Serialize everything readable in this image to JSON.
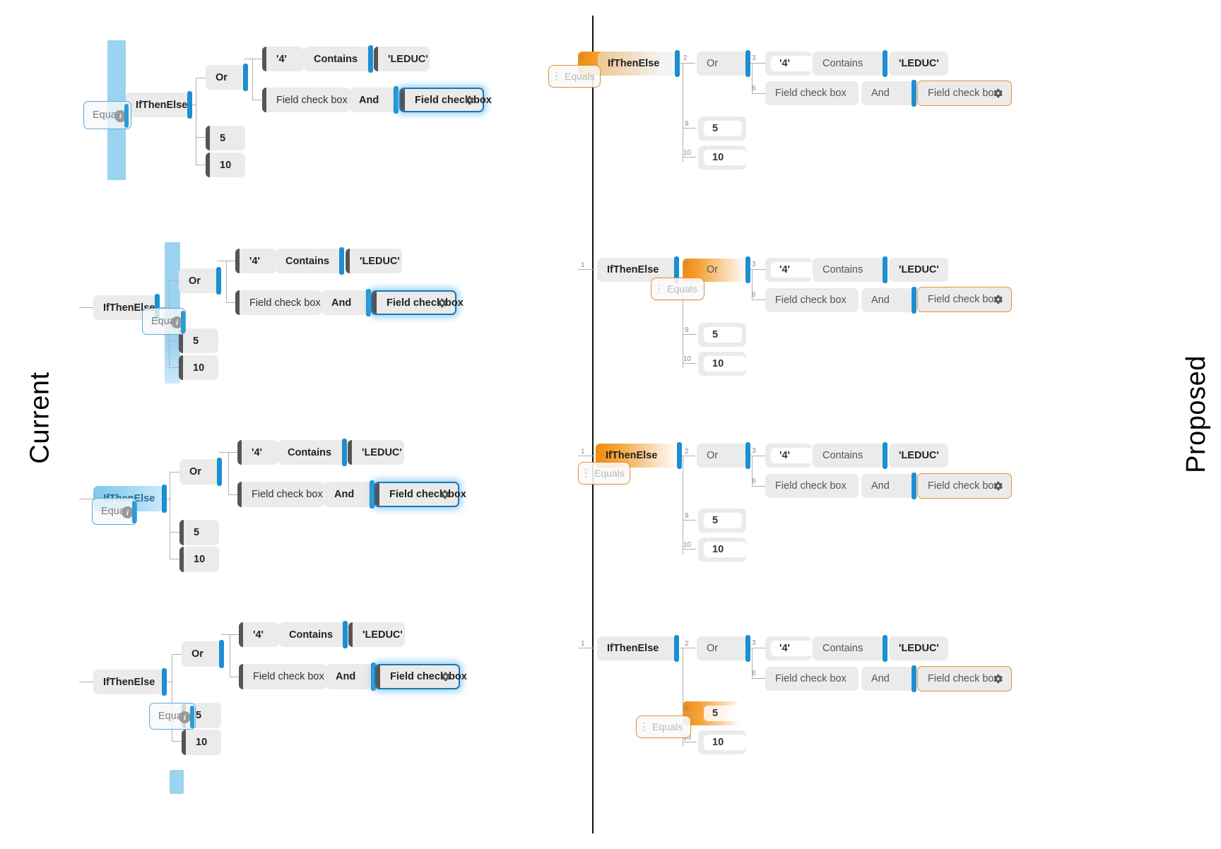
{
  "meta": {
    "left_caption": "Current",
    "right_caption": "Proposed"
  },
  "labels": {
    "if_then_else": "IfThenElse",
    "or": "Or",
    "and": "And",
    "contains": "Contains",
    "field_check_box": "Field check box",
    "equals": "Equals",
    "quote_four": "'4'",
    "leduc": "'LEDUC'",
    "five": "5",
    "ten": "10",
    "gear_icon": "gear-icon",
    "info_icon": "info-icon",
    "drag_handle_icon": "drag-handle-icon"
  },
  "connector_numbers": {
    "n1": "1",
    "n2": "2",
    "n3": "3",
    "n6": "6",
    "n9": "9",
    "n10": "10"
  },
  "colors": {
    "node_fill": "#ebebeb",
    "node_left_bar": "#555555",
    "node_right_bar": "#1b8fd1",
    "current_accent": "#1a77b8",
    "current_drop": "#9bd3f0",
    "proposed_accent": "#e8912f",
    "proposed_drop": "#f28b0c",
    "wire": "#b0b0b0",
    "canvas": "#ffffff"
  },
  "rows": [
    {
      "name": "row-1",
      "current": {
        "drop_kind": "vertical-insert-bar",
        "drop_target": "IfThenElse left edge",
        "ghost_label": "Equals"
      },
      "proposed": {
        "drop_kind": "slot-highlight",
        "drop_target": "slot 1 before IfThenElse",
        "ghost_label": "Equals"
      }
    },
    {
      "name": "row-2",
      "current": {
        "drop_kind": "vertical-insert-bar",
        "drop_target": "between IfThenElse and Or",
        "ghost_label": "Equals"
      },
      "proposed": {
        "drop_kind": "slot-highlight",
        "drop_target": "slot 2 before Or",
        "ghost_label": "Equals"
      }
    },
    {
      "name": "row-3",
      "current": {
        "drop_kind": "node-highlight",
        "drop_target": "IfThenElse node",
        "ghost_label": "Equals"
      },
      "proposed": {
        "drop_kind": "node-highlight",
        "drop_target": "IfThenElse node",
        "ghost_label": "Equals"
      }
    },
    {
      "name": "row-4",
      "current": {
        "drop_kind": "vertical-insert-bar",
        "drop_target": "value node 5",
        "ghost_label": "Equals"
      },
      "proposed": {
        "drop_kind": "node-highlight",
        "drop_target": "value node 5 (slot 9)",
        "ghost_label": "Equals"
      }
    }
  ]
}
